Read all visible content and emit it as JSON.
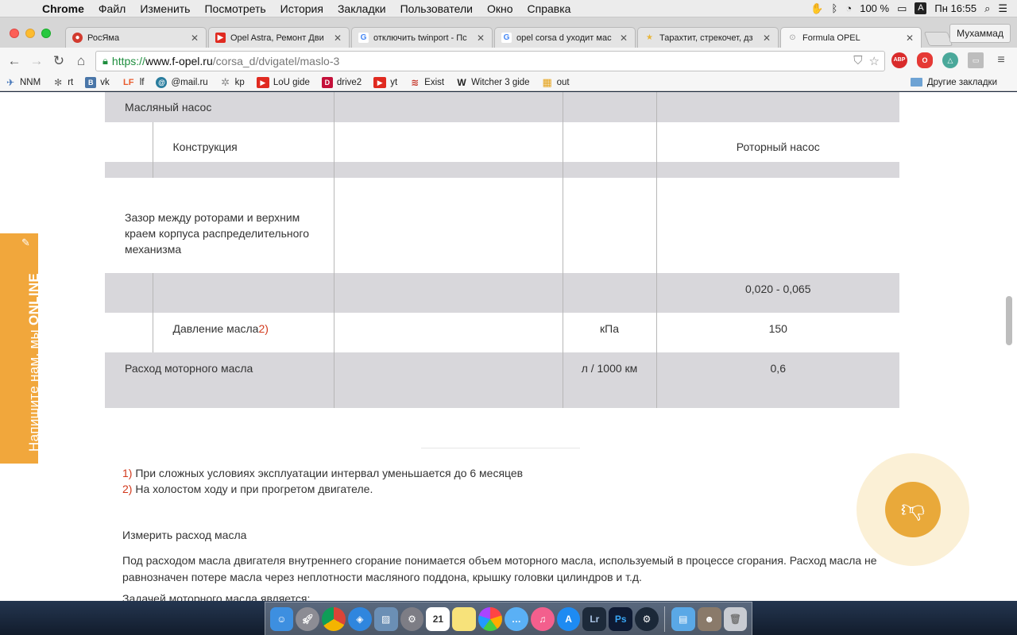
{
  "menubar": {
    "apple_icon": "",
    "app": "Chrome",
    "items": [
      "Файл",
      "Изменить",
      "Посмотреть",
      "История",
      "Закладки",
      "Пользователи",
      "Окно",
      "Справка"
    ],
    "battery": "100 %",
    "input_source": "A",
    "clock": "Пн 16:55"
  },
  "tabs": [
    {
      "title": "РосЯма",
      "fav_color": "#d23b2f",
      "fav_glyph": "●"
    },
    {
      "title": "Opel Astra, Ремонт Дви",
      "fav_color": "#e02a20",
      "fav_glyph": "▶"
    },
    {
      "title": "отключить twinport - Пс",
      "fav_color": "#4285f4",
      "fav_glyph": "G"
    },
    {
      "title": "opel corsa d уходит мас",
      "fav_color": "#4285f4",
      "fav_glyph": "G"
    },
    {
      "title": "Тарахтит, стрекочет, дз",
      "fav_color": "#e8b63a",
      "fav_glyph": "★"
    },
    {
      "title": "Formula OPEL",
      "fav_color": "#9a9a9a",
      "fav_glyph": "⊙"
    }
  ],
  "profile": "Мухаммад",
  "address": {
    "scheme": "https://",
    "host": "www.f-opel.ru",
    "path": "/corsa_d/dvigatel/maslo-3"
  },
  "bookmarks": [
    {
      "label": "NNM",
      "color": "#3b6fb6",
      "glyph": "✈"
    },
    {
      "label": "rt",
      "color": "#6b6b6b",
      "glyph": "✻"
    },
    {
      "label": "vk",
      "color": "#4a76a8",
      "glyph": "B"
    },
    {
      "label": "lf",
      "color": "#f3f3f3",
      "glyph": "LF"
    },
    {
      "label": "@mail.ru",
      "color": "#2a7d9e",
      "glyph": "@"
    },
    {
      "label": "kp",
      "color": "#8a8a8a",
      "glyph": "✲"
    },
    {
      "label": "LoU gide",
      "color": "#e02a20",
      "glyph": "▶"
    },
    {
      "label": "drive2",
      "color": "#c4103a",
      "glyph": "D"
    },
    {
      "label": "yt",
      "color": "#e02a20",
      "glyph": "▶"
    },
    {
      "label": "Exist",
      "color": "#c73a2e",
      "glyph": "≋"
    },
    {
      "label": "Witcher 3 gide",
      "color": "#222222",
      "glyph": "W"
    },
    {
      "label": "out",
      "color": "#e5a116",
      "glyph": "▦"
    }
  ],
  "other_bookmarks": "Другие закладки",
  "table": {
    "row1": {
      "label": "Масляный насос"
    },
    "row2": {
      "label": "Конструкция",
      "value": "Роторный насос"
    },
    "row4": {
      "label": "Зазор между роторами и верхним краем корпуса распределительного механизма"
    },
    "row5": {
      "value": "0,020 - 0,065"
    },
    "row6": {
      "label": "Давление масла",
      "footnote": "2)",
      "unit": "кПа",
      "value": "150"
    },
    "row7": {
      "label": "Расход моторного масла",
      "unit": "л / 1000 км",
      "value": "0,6"
    }
  },
  "notes": {
    "n1_mark": "1)",
    "n1_text": " При сложных условиях эксплуатации интервал уменьшается до 6 месяцев",
    "n2_mark": "2)",
    "n2_text": " На холостом ходу и при прогретом двигателе."
  },
  "section_title": "Измерить расход масла",
  "paragraph": "Под расходом масла двигателя внутреннего сгорание понимается объем моторного масла, используемый в процессе сгорания. Расход масла не равнозначен потере масла через неплотности масляного поддона, крышку головки цилиндров и т.д.",
  "paragraph2": "Задачей моторного масла является:",
  "online_widget": {
    "prefix": "Напишите нам, мы ",
    "highlight": "ONLINE"
  },
  "dock": {
    "calendar_day": "21",
    "apps": [
      "finder",
      "launchpad",
      "chrome",
      "safari",
      "preview",
      "system-preferences",
      "calendar",
      "notes",
      "photos",
      "messages",
      "itunes",
      "app-store",
      "lightroom",
      "photoshop",
      "steam",
      "downloads",
      "user",
      "trash"
    ]
  }
}
